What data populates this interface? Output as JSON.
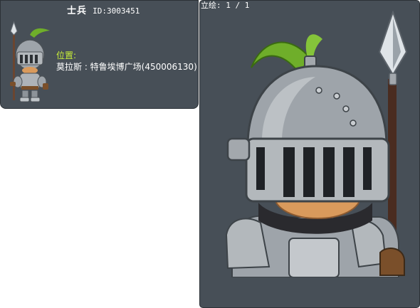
{
  "npc": {
    "name": "士兵",
    "id_text": "ID:3003451"
  },
  "location": {
    "label": "位置:",
    "value": "莫拉斯 : 特鲁埃博广场(450006130)"
  },
  "standee": {
    "counter": "立绘: 1 / 1"
  },
  "colors": {
    "panel_background": "#474f57",
    "location_label": "#c8ee38",
    "text": "#ffffff",
    "plume": "#6fae2a",
    "armor": "#a3a8ad"
  },
  "icons": {
    "small_sprite": "knight-soldier-sprite",
    "standee_art": "knight-soldier-portrait"
  }
}
